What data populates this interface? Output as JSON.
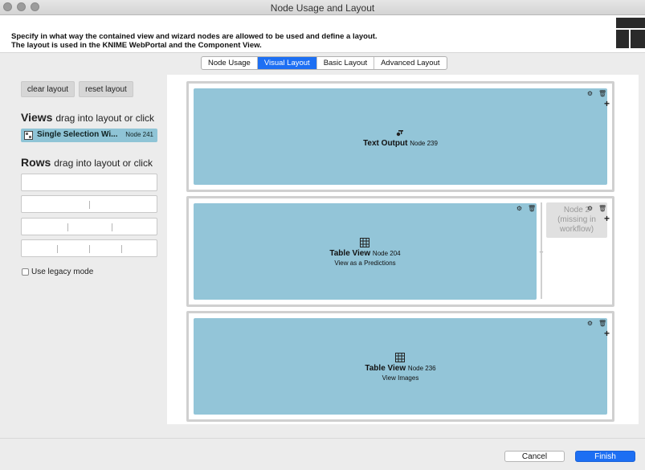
{
  "window": {
    "title": "Node Usage and Layout"
  },
  "header": {
    "line1": "Specify in what way the contained view and wizard nodes are allowed to be used and define a layout.",
    "line2": "The layout is used in the KNIME WebPortal and the Component View."
  },
  "tabs": [
    {
      "label": "Node Usage",
      "active": false
    },
    {
      "label": "Visual Layout",
      "active": true
    },
    {
      "label": "Basic Layout",
      "active": false
    },
    {
      "label": "Advanced Layout",
      "active": false
    }
  ],
  "left": {
    "clear_label": "clear layout",
    "reset_label": "reset layout",
    "views_title": "Views",
    "views_hint": "drag into layout or click",
    "views": [
      {
        "name": "Single Selection Wi...",
        "node": "Node 241"
      }
    ],
    "rows_title": "Rows",
    "rows_hint": "drag into layout or click",
    "legacy_label": "Use legacy mode",
    "legacy_checked": false
  },
  "layout": {
    "cells": [
      {
        "title": "Text Output",
        "node": "Node 239",
        "subtitle": ""
      },
      {
        "title": "Table View",
        "node": "Node 204",
        "subtitle": "View as a Predictions"
      },
      {
        "title": "Table View",
        "node": "Node 236",
        "subtitle": "View Images"
      }
    ],
    "missing": {
      "line1": "Node 2",
      "line2": "(missing in",
      "line3": "workflow)"
    }
  },
  "footer": {
    "cancel_label": "Cancel",
    "finish_label": "Finish"
  },
  "colors": {
    "accent": "#1d6ff3",
    "cell": "#93c5d8"
  }
}
